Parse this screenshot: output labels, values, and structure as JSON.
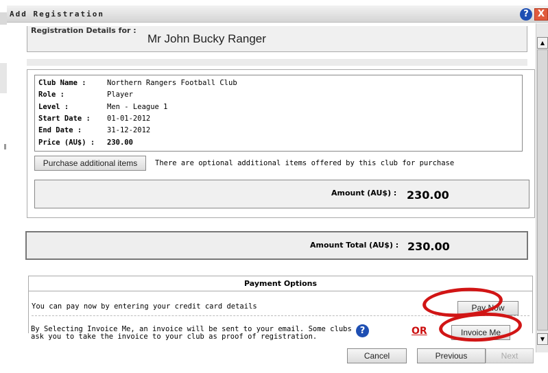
{
  "dialog": {
    "title": "Add Registration",
    "help_icon": "?",
    "close_icon": "X"
  },
  "registration": {
    "label": "Registration Details for :",
    "name": "Mr John Bucky Ranger"
  },
  "details": [
    {
      "label": "Club Name :",
      "value": "Northern Rangers Football Club"
    },
    {
      "label": "Role :",
      "value": "Player"
    },
    {
      "label": "Level :",
      "value": "Men - League 1"
    },
    {
      "label": "Start Date :",
      "value": "01-01-2012"
    },
    {
      "label": "End Date :",
      "value": "31-12-2012"
    },
    {
      "label": "Price (AU$) :",
      "value": "230.00"
    }
  ],
  "purchase": {
    "button_label": "Purchase additional items",
    "text": "There are optional additional items offered by this club for purchase"
  },
  "amount": {
    "label": "Amount (AU$) :",
    "value": "230.00"
  },
  "total": {
    "label": "Amount Total (AU$) :",
    "value": "230.00"
  },
  "payment": {
    "heading": "Payment Options",
    "pay_now_text": "You can pay now by entering your credit card details",
    "pay_now_button": "Pay Now",
    "invoice_text": "By Selecting Invoice Me, an invoice will be sent to your email. Some clubs ask you to take the invoice to your club as proof of registration.",
    "or_text": "OR",
    "invoice_button": "Invoice Me"
  },
  "footer": {
    "cancel": "Cancel",
    "previous": "Previous",
    "next": "Next"
  },
  "colors": {
    "highlight": "#d11515",
    "help_blue": "#1e4fb3"
  }
}
